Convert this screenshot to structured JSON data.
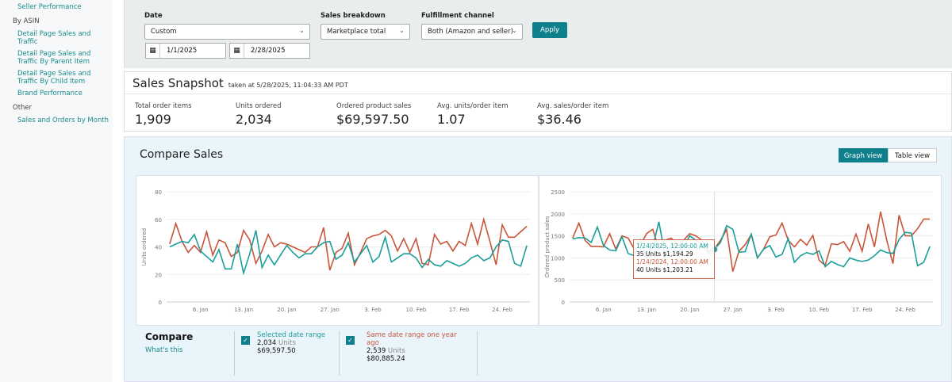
{
  "sidebar": {
    "items": [
      {
        "label": "Seller Performance"
      }
    ],
    "group_asin": "By ASIN",
    "asin_items": [
      {
        "label": "Detail Page Sales and Traffic"
      },
      {
        "label": "Detail Page Sales and Traffic By Parent Item"
      },
      {
        "label": "Detail Page Sales and Traffic By Child Item"
      },
      {
        "label": "Brand Performance"
      }
    ],
    "group_other": "Other",
    "other_items": [
      {
        "label": "Sales and Orders by Month"
      }
    ]
  },
  "filters": {
    "date_label": "Date",
    "date_value": "Custom",
    "start_date": "1/1/2025",
    "end_date": "2/28/2025",
    "breakdown_label": "Sales breakdown",
    "breakdown_value": "Marketplace total",
    "channel_label": "Fulfillment channel",
    "channel_value": "Both (Amazon and seller)",
    "apply": "Apply"
  },
  "snapshot": {
    "title": "Sales Snapshot",
    "subtitle": "taken at 5/28/2025, 11:04:33 AM PDT",
    "metrics": [
      {
        "label": "Total order items",
        "value": "1,909"
      },
      {
        "label": "Units ordered",
        "value": "2,034"
      },
      {
        "label": "Ordered product sales",
        "value": "$69,597.50"
      },
      {
        "label": "Avg. units/order item",
        "value": "1.07"
      },
      {
        "label": "Avg. sales/order item",
        "value": "$36.46"
      }
    ]
  },
  "compare": {
    "title": "Compare Sales",
    "graph_view": "Graph view",
    "table_view": "Table view",
    "compare_label": "Compare",
    "whats_this": "What's this",
    "selected": {
      "label": "Selected date range",
      "units": "2,034",
      "units_word": "Units",
      "sales": "$69,597.50"
    },
    "prior": {
      "label": "Same date range one year ago",
      "units": "2,539",
      "units_word": "Units",
      "sales": "$80,885.24"
    }
  },
  "tooltip": {
    "line1": "1/24/2025, 12:00:00 AM",
    "line2": "35 Units $1,194.29",
    "line3": "1/24/2024, 12:00:00 AM",
    "line4": "40 Units $1,203.21"
  },
  "colors": {
    "current": "#1a9e9a",
    "prior": "#c8553a",
    "accent": "#107f8c"
  },
  "chart_data": [
    {
      "type": "line",
      "ylabel": "Units ordered",
      "ylim": [
        0,
        80
      ],
      "yticks": [
        "0",
        "20",
        "40",
        "60",
        "80"
      ],
      "xticks": [
        "6. Jan",
        "13. Jan",
        "20. Jan",
        "27. Jan",
        "3. Feb",
        "10. Feb",
        "17. Feb",
        "24. Feb"
      ],
      "x_start": "2025-01-01",
      "series": [
        {
          "name": "Selected date range",
          "values": [
            40,
            42,
            44,
            43,
            49,
            37,
            33,
            29,
            38,
            24,
            24,
            42,
            21,
            35,
            52,
            25,
            34,
            27,
            34,
            41,
            36,
            32,
            35,
            35,
            40,
            43,
            44,
            31,
            34,
            43,
            29,
            35,
            41,
            29,
            33,
            47,
            29,
            32,
            35,
            35,
            32,
            25,
            31,
            27,
            26,
            30,
            28,
            26,
            28,
            32,
            34,
            30,
            32,
            40,
            45,
            44,
            28,
            26,
            41
          ]
        },
        {
          "name": "Same date range one year ago",
          "values": [
            42,
            57,
            44,
            36,
            41,
            36,
            51,
            34,
            45,
            43,
            33,
            36,
            52,
            45,
            28,
            37,
            49,
            40,
            43,
            42,
            40,
            38,
            36,
            40,
            40,
            54,
            23,
            36,
            39,
            50,
            27,
            36,
            46,
            48,
            49,
            52,
            48,
            37,
            46,
            36,
            46,
            28,
            27,
            49,
            42,
            44,
            37,
            44,
            41,
            57,
            42,
            60,
            44,
            27,
            56,
            47,
            47,
            51,
            55
          ]
        }
      ]
    },
    {
      "type": "line",
      "ylabel": "Ordered product sales",
      "ylim": [
        0,
        2500
      ],
      "yticks": [
        "0",
        "500",
        "1000",
        "1500",
        "2000",
        "2500"
      ],
      "xticks": [
        "6. Jan",
        "13. Jan",
        "20. Jan",
        "27. Jan",
        "3. Feb",
        "10. Feb",
        "17. Feb",
        "24. Feb"
      ],
      "x_start": "2025-01-01",
      "series": [
        {
          "name": "Selected date range",
          "values": [
            1430,
            1460,
            1450,
            1350,
            1700,
            1280,
            1180,
            1160,
            1480,
            1100,
            1050,
            1400,
            1000,
            1250,
            1820,
            1050,
            1300,
            1100,
            1250,
            1500,
            1400,
            1300,
            1100,
            1194,
            1350,
            1730,
            1650,
            1130,
            1140,
            1540,
            1000,
            1200,
            1280,
            1020,
            1080,
            1440,
            900,
            1050,
            1120,
            1080,
            1160,
            800,
            920,
            850,
            800,
            1000,
            950,
            920,
            950,
            1050,
            1180,
            1120,
            1100,
            1420,
            1580,
            1560,
            820,
            900,
            1260
          ]
        },
        {
          "name": "Same date range one year ago",
          "values": [
            1450,
            1790,
            1400,
            1260,
            1260,
            1250,
            1550,
            1200,
            1500,
            1450,
            1200,
            1300,
            1550,
            1650,
            1200,
            1400,
            1450,
            1300,
            1400,
            1550,
            1500,
            1400,
            1150,
            1203,
            1400,
            1640,
            690,
            1150,
            1300,
            1530,
            1000,
            1200,
            1480,
            1520,
            1790,
            1400,
            1250,
            1420,
            1290,
            1510,
            950,
            830,
            1320,
            1300,
            1370,
            1150,
            1540,
            1150,
            1770,
            1250,
            2050,
            1400,
            870,
            1970,
            1500,
            1500,
            1660,
            1880,
            1880
          ]
        }
      ]
    }
  ]
}
